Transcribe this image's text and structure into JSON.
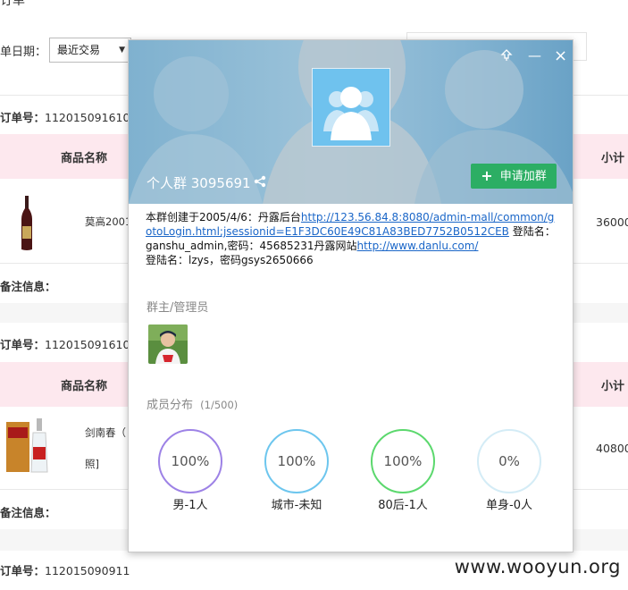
{
  "page": {
    "title_fragment": "订单",
    "date_filter": {
      "label": "单日期：",
      "value": "最近交易"
    },
    "orders": [
      {
        "order_label": "订单号：",
        "order_no": "112015091610",
        "columns": {
          "product": "商品名称",
          "subtotal": "小计"
        },
        "product_name": "莫高2001",
        "subtotal": "36000",
        "note_label": "备注信息："
      },
      {
        "order_label": "订单号：",
        "order_no": "112015091610",
        "columns": {
          "product": "商品名称",
          "subtotal": "小计"
        },
        "product_name_line1": "剑南春（",
        "product_name_line2": "照]",
        "subtotal": "40800",
        "note_label": "备注信息："
      },
      {
        "order_label": "订单号：",
        "order_no": "112015090911"
      }
    ]
  },
  "popup": {
    "controls": {
      "pin_icon": "pin-icon",
      "minimize": "—",
      "close": "×"
    },
    "group_name": "个人群 3095691",
    "join_button": {
      "plus": "+",
      "label": "申请加群"
    },
    "description": {
      "text1": "本群创建于2005/4/6：丹露后台",
      "link1": "http://123.56.84.8:8080/admin-mall/common/gotoLogin.html;jsessionid=E1F3DC60E49C81A83BED7752B0512CEB",
      "text2": " 登陆名：ganshu_admin,密码：45685231丹露网站",
      "link2": "http://www.danlu.com/",
      "text3": "登陆名：lzys，密码gsys2650666"
    },
    "admins_label": "群主/管理员",
    "members_label": "成员分布",
    "members_count": "(1/500)",
    "stats": [
      {
        "value": "100%",
        "label": "男-1人",
        "color": "#9d82e6"
      },
      {
        "value": "100%",
        "label": "城市-未知",
        "color": "#6dc6ee"
      },
      {
        "value": "100%",
        "label": "80后-1人",
        "color": "#5bd86d"
      },
      {
        "value": "0%",
        "label": "单身-0人",
        "color": "#d4ecf6"
      }
    ]
  },
  "watermark": "www.wooyun.org"
}
